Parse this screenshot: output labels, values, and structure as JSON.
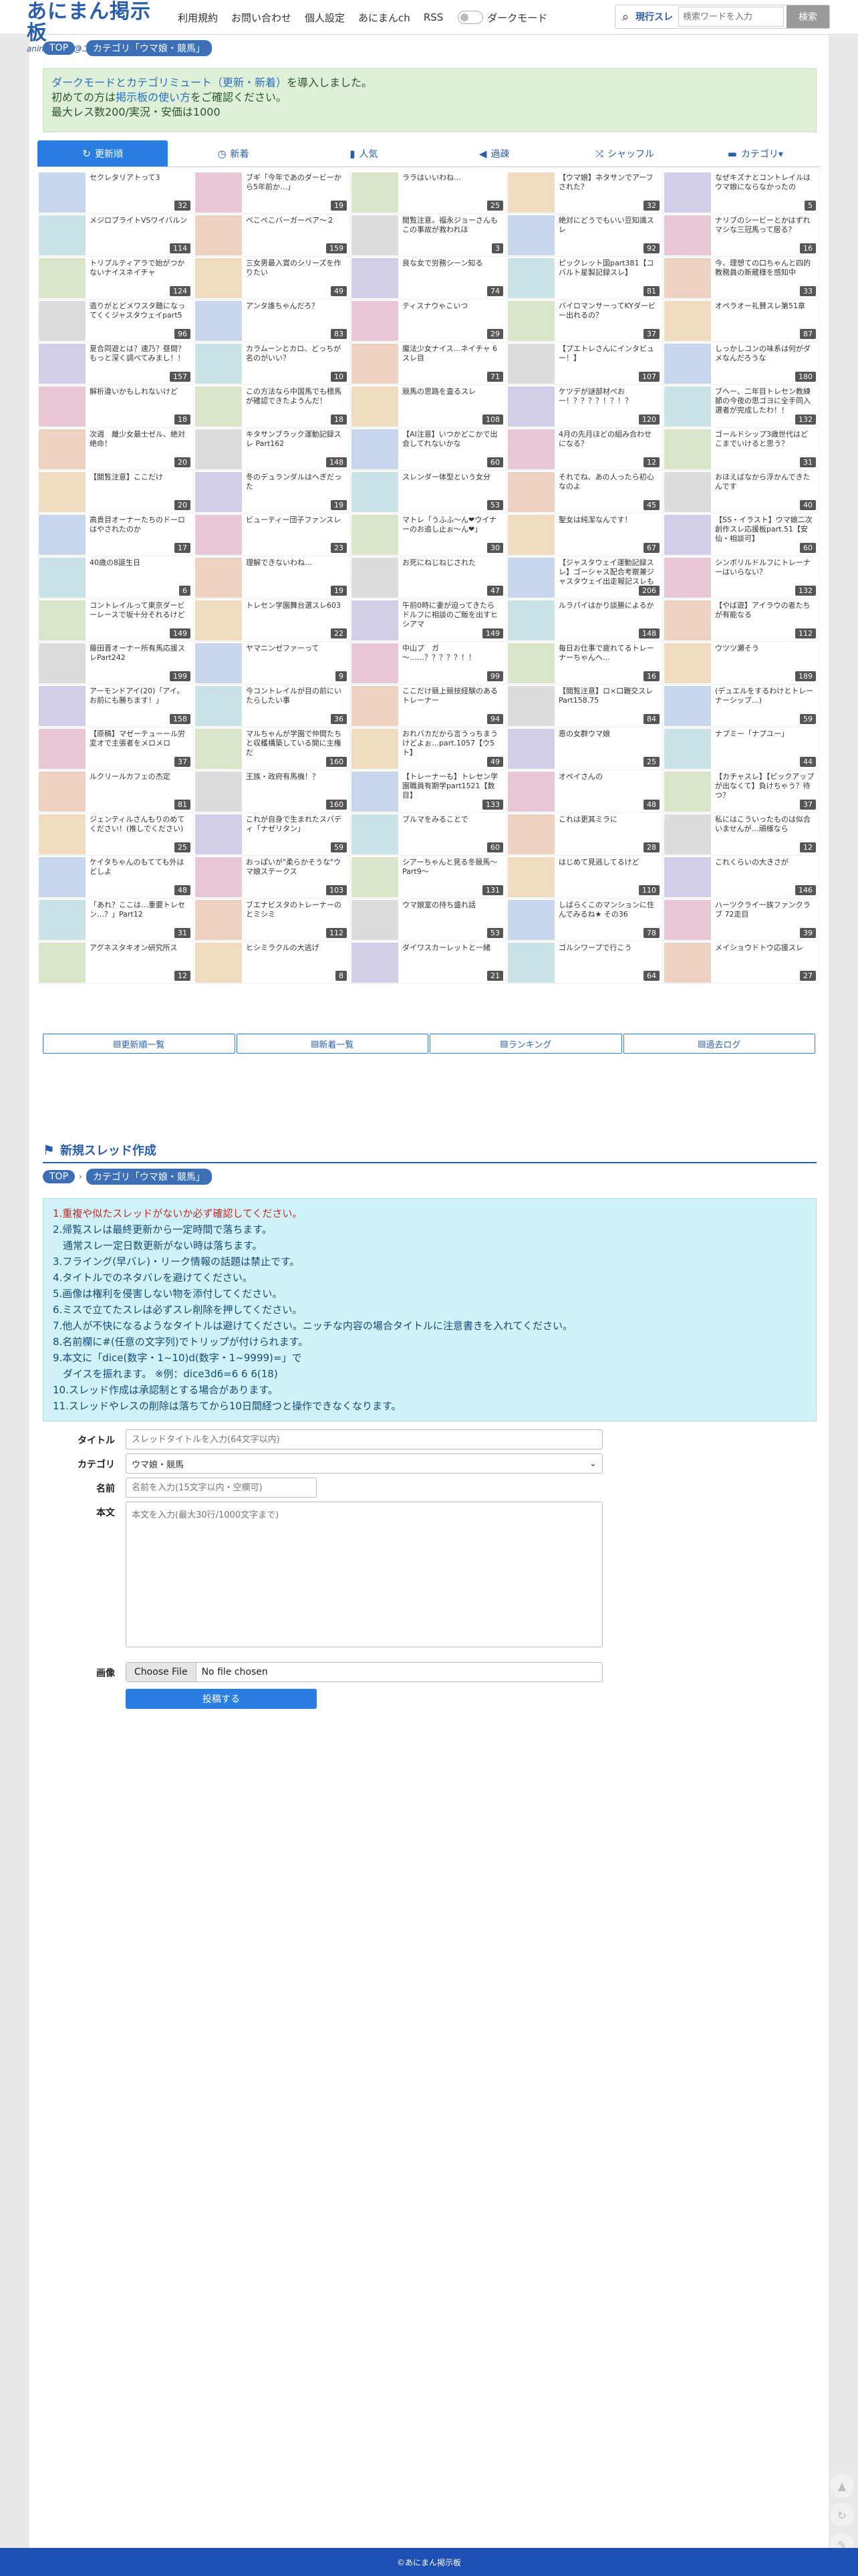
{
  "header": {
    "logo_title": "あにまん掲示板",
    "logo_sub": "animan bbs@二次元オンリー",
    "nav": [
      "利用規約",
      "お問い合わせ",
      "個人設定",
      "あにまんch",
      "RSS"
    ],
    "dark_mode_label": "ダークモード",
    "search_scope": "現行スレ",
    "search_placeholder": "検索ワードを入力",
    "search_button": "検索"
  },
  "breadcrumb": [
    "TOP",
    "カテゴリ「ウマ娘・競馬」"
  ],
  "notice": {
    "line1_link": "ダークモードとカテゴリミュート（更新・新着）",
    "line1_rest": "を導入しました。",
    "line2_pre": "初めての方は",
    "line2_link": "掲示板の使い方",
    "line2_post": "をご確認ください。",
    "line3": "最大レス数200/実況・安価は1000"
  },
  "tabs": [
    {
      "icon": "refresh-icon",
      "glyph": "↻",
      "label": "更新順"
    },
    {
      "icon": "clock-icon",
      "glyph": "◷",
      "label": "新着"
    },
    {
      "icon": "bar-chart-icon",
      "glyph": "▮",
      "label": "人気"
    },
    {
      "icon": "speaker-icon",
      "glyph": "◀",
      "label": "過疎"
    },
    {
      "icon": "shuffle-icon",
      "glyph": "⤨",
      "label": "シャッフル"
    },
    {
      "icon": "folder-icon",
      "glyph": "▬",
      "label": "カテゴリ▾"
    }
  ],
  "threads": [
    {
      "title": "セクレタリアトって3",
      "count": "32"
    },
    {
      "title": "ブギ「今年であのダービーから5年前か…」",
      "count": "19"
    },
    {
      "title": "ララはいいわね…",
      "count": "25"
    },
    {
      "title": "【ウマ娘】ネタサンでアーフされた？",
      "count": "32"
    },
    {
      "title": "なぜキズナとコントレイルはウマ娘にならなかったの",
      "count": "5"
    },
    {
      "title": "メジロブライトVSワイバルン",
      "count": "114"
    },
    {
      "title": "ぺこぺこバーガーペア～２",
      "count": "159"
    },
    {
      "title": "閲覧注意。福永ジョーさんもこの事故が救われほ",
      "count": "3"
    },
    {
      "title": "絶対にどうでもいい豆知識スレ",
      "count": "92"
    },
    {
      "title": "ナリブのシービーとかはずれマシな三冠馬って居る？",
      "count": "16"
    },
    {
      "title": "トリプルティアラで始がつかないナイスネイチャ",
      "count": "124"
    },
    {
      "title": "三女男最入賞のシリーズを作りたい",
      "count": "49"
    },
    {
      "title": "良な女で労務シーン知る",
      "count": "74"
    },
    {
      "title": "ピックレット国part381【コバルト星製記録スレ】",
      "count": "81"
    },
    {
      "title": "今、理想ての口ちゃんと四的教務員の新蔵様を感知中",
      "count": "33"
    },
    {
      "title": "造りがとどメワスタ聴になってくくジャスタウェイpart5",
      "count": "96"
    },
    {
      "title": "アンタ誰ちゃんだろ？",
      "count": "83"
    },
    {
      "title": "ティスナウゃこいつ",
      "count": "29"
    },
    {
      "title": "バイロマンサーってKYダービー出れるの？",
      "count": "37"
    },
    {
      "title": "オペラオー礼賛スレ第51章",
      "count": "87"
    },
    {
      "title": "夏合同遊とは？速乃？昼間？もっと深く調べてみまし！！",
      "count": "157"
    },
    {
      "title": "カラムーンとカロ、どっちが名のがいい？",
      "count": "10"
    },
    {
      "title": "魔法少女ナイス…ネイチャ 6スレ目",
      "count": "71"
    },
    {
      "title": "【プエトレさんにインタビュー！】",
      "count": "107"
    },
    {
      "title": "しっかしコンの味系は何がダメなんだろうな",
      "count": "180"
    },
    {
      "title": "解析違いかもしれないけど",
      "count": "18"
    },
    {
      "title": "この方法なら中国馬でも標馬が確認できたようんだ！",
      "count": "18"
    },
    {
      "title": "競馬の思路を査るスレ",
      "count": "108"
    },
    {
      "title": "ケツデが謎部材ぺお一！？？？？！？！？",
      "count": "120"
    },
    {
      "title": "ブヘー、二年目トレセン教練節の今夜の思ゴヨに全手同入選者が完成したわ！！",
      "count": "132"
    },
    {
      "title": "次週　離少女最士ゼル、絶対絶命！",
      "count": "20"
    },
    {
      "title": "キタサンブラック運動記録スレ Part162",
      "count": "148"
    },
    {
      "title": "【AI注意】いつかどこかで出会してれないかな",
      "count": "60"
    },
    {
      "title": "4月の先月ほどの組み合わせになる？",
      "count": "12"
    },
    {
      "title": "ゴールドシップ3歳世代はどこまでいけると思う？",
      "count": "31"
    },
    {
      "title": "【閲覧注意】ここだけ",
      "count": "20"
    },
    {
      "title": "冬のデュランダルはへぎだった",
      "count": "19"
    },
    {
      "title": "スレンダー体型という女分",
      "count": "53"
    },
    {
      "title": "それでね、あの人ったら初心なのよ",
      "count": "45"
    },
    {
      "title": "おほえばなから浮かんできたんです",
      "count": "40"
    },
    {
      "title": "高貴目オーナーたちのドーロはやされたのか",
      "count": "17"
    },
    {
      "title": "ビューティー団子ファンスレ",
      "count": "23"
    },
    {
      "title": "マトレ「うふふ～ん❤ウイナーのお追し止ぉ～ん❤」",
      "count": "30"
    },
    {
      "title": "聖女は純潔なんです！",
      "count": "67"
    },
    {
      "title": "【SS・イラスト】ウマ娘二次創作スレ応援板part.51【安仙・相談可】",
      "count": "60"
    },
    {
      "title": "40歳の8誕生日",
      "count": "6"
    },
    {
      "title": "理解できないわね…",
      "count": "19"
    },
    {
      "title": "お死にねじねじされた",
      "count": "47"
    },
    {
      "title": "【ジャスタウェイ運動記録スレ】ゴーシャス配合考察兼ジャスタウェイ出走報記スレも",
      "count": "206"
    },
    {
      "title": "シンボリルドルフにトレーナーはいらない？",
      "count": "132"
    },
    {
      "title": "コントレイルって東京ダービーレースで坂十分それるけど",
      "count": "149"
    },
    {
      "title": "トレセン学園舞台選スレ603",
      "count": "22"
    },
    {
      "title": "午前0時に妻が迫ってきたらドルフに相談のご飯を出すヒシアマ",
      "count": "149"
    },
    {
      "title": "ルラパイはかり談勝によるか",
      "count": "148"
    },
    {
      "title": "【やば遊】アイラウの者たちが有能なる",
      "count": "112"
    },
    {
      "title": "藤田晋オーナー所有馬応援スレPart242",
      "count": "199"
    },
    {
      "title": "ヤマニンゼファーって",
      "count": "9"
    },
    {
      "title": "中山プ　ガ～……？？？？？！！",
      "count": "99"
    },
    {
      "title": "毎日お仕事で疲れてるトレーナーちゃんへ…",
      "count": "16"
    },
    {
      "title": "ウツツ瀬そう",
      "count": "189"
    },
    {
      "title": "アーモンドアイ(20)「アイ。お前にも勝ちます！」",
      "count": "158"
    },
    {
      "title": "今コントレイルが目の前にいたらしたい事",
      "count": "36"
    },
    {
      "title": "ここだけ競上競技経験のあるトレーナー",
      "count": "94"
    },
    {
      "title": "【閲覧注意】ロ×口難交スレPart158.75",
      "count": "84"
    },
    {
      "title": "(デュエルをするわけとトレーナーシップ…)",
      "count": "59"
    },
    {
      "title": "【原稿】マゼーテューール労変オで主張者をメロメロ",
      "count": "37"
    },
    {
      "title": "マルちゃんが学園で仲間たちと収穫構築している開に主権だ",
      "count": "160"
    },
    {
      "title": "おれバカだから言うっちまうけどよぉ…part.1057【ウ5ト】",
      "count": "49"
    },
    {
      "title": "恩の女群ウマ娘",
      "count": "25"
    },
    {
      "title": "ナプミー「ナプユー」",
      "count": "44"
    },
    {
      "title": "ルクリールカフェの杰定",
      "count": "81"
    },
    {
      "title": "王族・政府有馬機！？",
      "count": "160"
    },
    {
      "title": "【トレーナーも】トレセン学園職員有期学part1521【数目】",
      "count": "133"
    },
    {
      "title": "オペイさんの",
      "count": "48"
    },
    {
      "title": "【カチャスレ】【ピックアップが出なくて】負けちゃう？待つ？",
      "count": "37"
    },
    {
      "title": "ジェンティルさんもりのめてください！(推しでください)",
      "count": "25"
    },
    {
      "title": "これが自身で生まれたスバディ「ナゼリタン」",
      "count": "59"
    },
    {
      "title": "ブルマをみることで",
      "count": "60"
    },
    {
      "title": "これは更其ミラに",
      "count": "28"
    },
    {
      "title": "私にはこういったものは似合いませんが…頑様なら",
      "count": "12"
    },
    {
      "title": "ケイタちゃんのもてても外はどしよ",
      "count": "48"
    },
    {
      "title": "おっぱいが\"柔らかそうな\"ウマ娘ステークス",
      "count": "103"
    },
    {
      "title": "シアーちゃんと見る冬競馬～Part9～",
      "count": "131"
    },
    {
      "title": "はじめて見逃してるけど",
      "count": "110"
    },
    {
      "title": "これくらいの大きさが",
      "count": "146"
    },
    {
      "title": "「あれ？ここは…重要トレセン…？」Part12",
      "count": "31"
    },
    {
      "title": "ブエナビスタのトレーナーのとミシミ",
      "count": "112"
    },
    {
      "title": "ウマ娘室の持ち盛れ話",
      "count": "53"
    },
    {
      "title": "しばらくこのマンションに住んでみるね★ その36",
      "count": "78"
    },
    {
      "title": "ハーツクライ一族ファンクラブ 72走目",
      "count": "39"
    },
    {
      "title": "アグネスタキオン研究所ス",
      "count": "12"
    },
    {
      "title": "ヒシミラクルの大逃げ",
      "count": "8"
    },
    {
      "title": "ダイワスカーレットと一緒",
      "count": "21"
    },
    {
      "title": "ゴルシワープで行こう",
      "count": "64"
    },
    {
      "title": "メイショウドトウ応援スレ",
      "count": "27"
    }
  ],
  "link_bar": [
    {
      "icon": "list-icon",
      "label": "更新順一覧"
    },
    {
      "icon": "new-list-icon",
      "label": "新着一覧"
    },
    {
      "icon": "ranking-icon",
      "label": "ランキング"
    },
    {
      "icon": "history-icon",
      "label": "過去ログ"
    }
  ],
  "new_thread": {
    "heading": "新規スレッド作成",
    "rules": [
      "1.重複や似たスレッドがないか必ず確認してください。",
      "2.帰覧スレは最終更新から一定時間で落ちます。",
      "　通常スレ一定日数更新がない時は落ちます。",
      "3.フライング(早バレ)・リーク情報の話題は禁止です。",
      "4.タイトルでのネタバレを避けてください。",
      "5.画像は権利を侵害しない物を添付してください。",
      "6.ミスで立てたスレは必ずスレ削除を押してください。",
      "7.他人が不快になるようなタイトルは避けてください。ニッチな内容の場合タイトルに注意書きを入れてください。",
      "8.名前欄に#(任意の文字列)でトリップが付けられます。",
      "9.本文に「dice(数字・1~10)d(数字・1~9999)=」で",
      "　ダイスを振れます。 ※例：dice3d6=6 6 6(18)",
      "10.スレッド作成は承認制とする場合があります。",
      "11.スレッドやレスの削除は落ちてから10日間経つと操作できなくなります。"
    ],
    "form": {
      "title_label": "タイトル",
      "title_placeholder": "スレッドタイトルを入力(64文字以内)",
      "category_label": "カテゴリ",
      "category_value": "ウマ娘・競馬",
      "name_label": "名前",
      "name_placeholder": "名前を入力(15文字以内・空欄可)",
      "body_label": "本文",
      "body_placeholder": "本文を入力(最大30行/1000文字まで)",
      "image_label": "画像",
      "file_button": "Choose File",
      "file_status": "No file chosen",
      "submit_label": "投稿する"
    }
  },
  "footer": "©あにまん掲示板",
  "colors": {
    "brand": "#2a5ea8",
    "accent": "#2a7de1",
    "notice_bg": "#dff0d8",
    "rules_bg": "#d1f3f7",
    "footer_bg": "#1e4fb3"
  }
}
